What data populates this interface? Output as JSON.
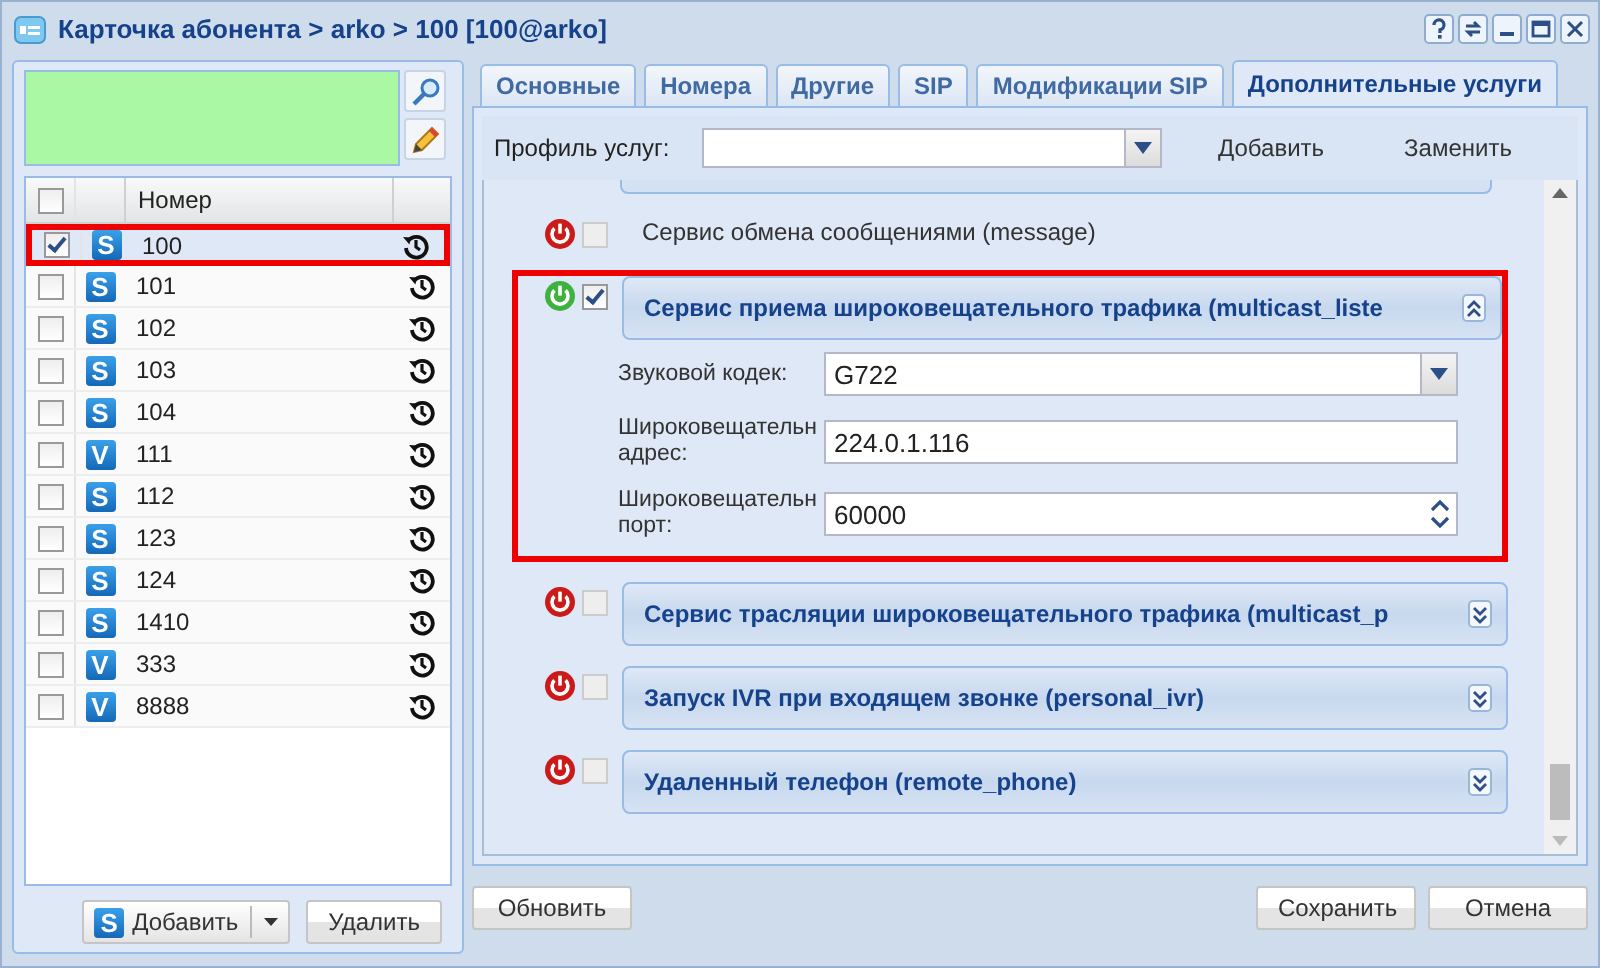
{
  "window": {
    "title": "Карточка абонента > arko > 100 [100@arko]"
  },
  "numbers_grid": {
    "all_checked": false,
    "columns": [
      "Номер"
    ],
    "rows": [
      {
        "number": "100",
        "badge": "S",
        "checked": true,
        "highlighted": true
      },
      {
        "number": "101",
        "badge": "S",
        "checked": false,
        "highlighted": false
      },
      {
        "number": "102",
        "badge": "S",
        "checked": false,
        "highlighted": false
      },
      {
        "number": "103",
        "badge": "S",
        "checked": false,
        "highlighted": false
      },
      {
        "number": "104",
        "badge": "S",
        "checked": false,
        "highlighted": false
      },
      {
        "number": "111",
        "badge": "V",
        "checked": false,
        "highlighted": false
      },
      {
        "number": "112",
        "badge": "S",
        "checked": false,
        "highlighted": false
      },
      {
        "number": "123",
        "badge": "S",
        "checked": false,
        "highlighted": false
      },
      {
        "number": "124",
        "badge": "S",
        "checked": false,
        "highlighted": false
      },
      {
        "number": "1410",
        "badge": "S",
        "checked": false,
        "highlighted": false
      },
      {
        "number": "333",
        "badge": "V",
        "checked": false,
        "highlighted": false
      },
      {
        "number": "8888",
        "badge": "V",
        "checked": false,
        "highlighted": false
      }
    ],
    "add_button": {
      "badge": "S",
      "label": "Добавить"
    },
    "delete_button": "Удалить"
  },
  "tabs": [
    {
      "label": "Основные",
      "selected": false
    },
    {
      "label": "Номера",
      "selected": false
    },
    {
      "label": "Другие",
      "selected": false
    },
    {
      "label": "SIP",
      "selected": false
    },
    {
      "label": "Модификации SIP",
      "selected": false
    },
    {
      "label": "Дополнительные услуги",
      "selected": true
    }
  ],
  "profile": {
    "label": "Профиль услуг:",
    "buttons": [
      "Добавить",
      "Заменить"
    ]
  },
  "services": [
    {
      "kind": "row",
      "title": "Сервис обмена сообщениями (message)",
      "enabled": false,
      "checked": false,
      "highlighted": false
    },
    {
      "kind": "panel",
      "title": "Сервис приема широковещательного трафика (multicast_liste",
      "enabled": true,
      "checked": true,
      "expanded": true,
      "highlighted": true,
      "fields": [
        {
          "kind": "select",
          "label": "Звуковой кодек:",
          "value": "G722"
        },
        {
          "kind": "text",
          "label": "Широковещательн\nадрес:",
          "value": "224.0.1.116"
        },
        {
          "kind": "spinner",
          "label": "Широковещательн\nпорт:",
          "value": "60000"
        }
      ]
    },
    {
      "kind": "panel",
      "title": "Сервис трасляции широковещательного трафика (multicast_p",
      "enabled": false,
      "checked": false,
      "expanded": false,
      "highlighted": false
    },
    {
      "kind": "panel",
      "title": "Запуск IVR при входящем звонке (personal_ivr)",
      "enabled": false,
      "checked": false,
      "expanded": false,
      "highlighted": false
    },
    {
      "kind": "panel",
      "title": "Удаленный телефон (remote_phone)",
      "enabled": false,
      "checked": false,
      "expanded": false,
      "highlighted": false
    }
  ],
  "footer": {
    "refresh": "Обновить",
    "save": "Сохранить",
    "cancel": "Отмена"
  }
}
